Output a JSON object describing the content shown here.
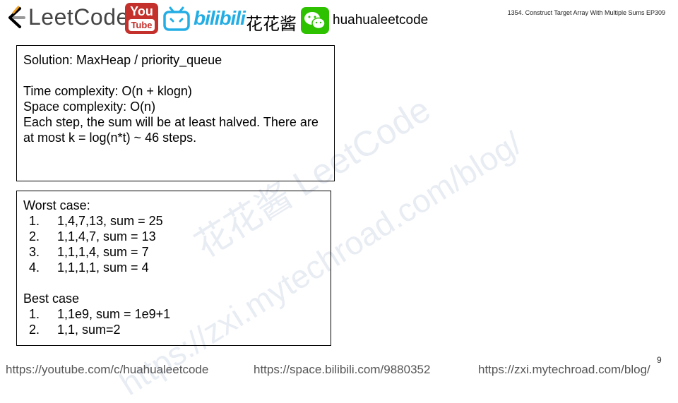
{
  "header": {
    "brand_text": "LeetCode",
    "youtube_top": "You",
    "youtube_bottom": "Tube",
    "bilibili_text": "bilibili",
    "chinese_name": "花花酱",
    "handle": "huahualeetcode",
    "episode_title": "1354. Construct Target Array With Multiple Sums EP309"
  },
  "watermarks": {
    "primary": "花花酱 LeetCode",
    "secondary": "https://zxi.mytechroad.com/blog/"
  },
  "solution_box": {
    "title": "Solution: MaxHeap / priority_queue",
    "time_complexity": "Time complexity: O(n + klogn)",
    "space_complexity": "Space complexity: O(n)",
    "explanation": "Each step, the sum will be at least halved. There are at most  k = log(n*t) ~ 46 steps."
  },
  "cases_box": {
    "worst_label": "Worst case:",
    "worst_items": [
      {
        "num": "1.",
        "text": "1,4,7,13, sum = 25"
      },
      {
        "num": "2.",
        "text": "1,1,4,7, sum = 13"
      },
      {
        "num": "3.",
        "text": "1,1,1,4, sum = 7"
      },
      {
        "num": "4.",
        "text": "1,1,1,1, sum = 4"
      }
    ],
    "best_label": "Best case",
    "best_items": [
      {
        "num": "1.",
        "text": "1,1e9, sum = 1e9+1"
      },
      {
        "num": "2.",
        "text": "1,1, sum=2"
      }
    ]
  },
  "footer": {
    "youtube_url": "https://youtube.com/c/huahualeetcode",
    "bilibili_url": "https://space.bilibili.com/9880352",
    "blog_url": "https://zxi.mytechroad.com/blog/",
    "page_number": "9"
  },
  "colors": {
    "youtube_red": "#c4302b",
    "bilibili_blue": "#23ade5",
    "wechat_green": "#2dc100",
    "watermark": "#e8ecf3"
  },
  "icons": [
    "leetcode-logo-icon",
    "youtube-logo-icon",
    "bilibili-tv-icon",
    "wechat-icon"
  ]
}
